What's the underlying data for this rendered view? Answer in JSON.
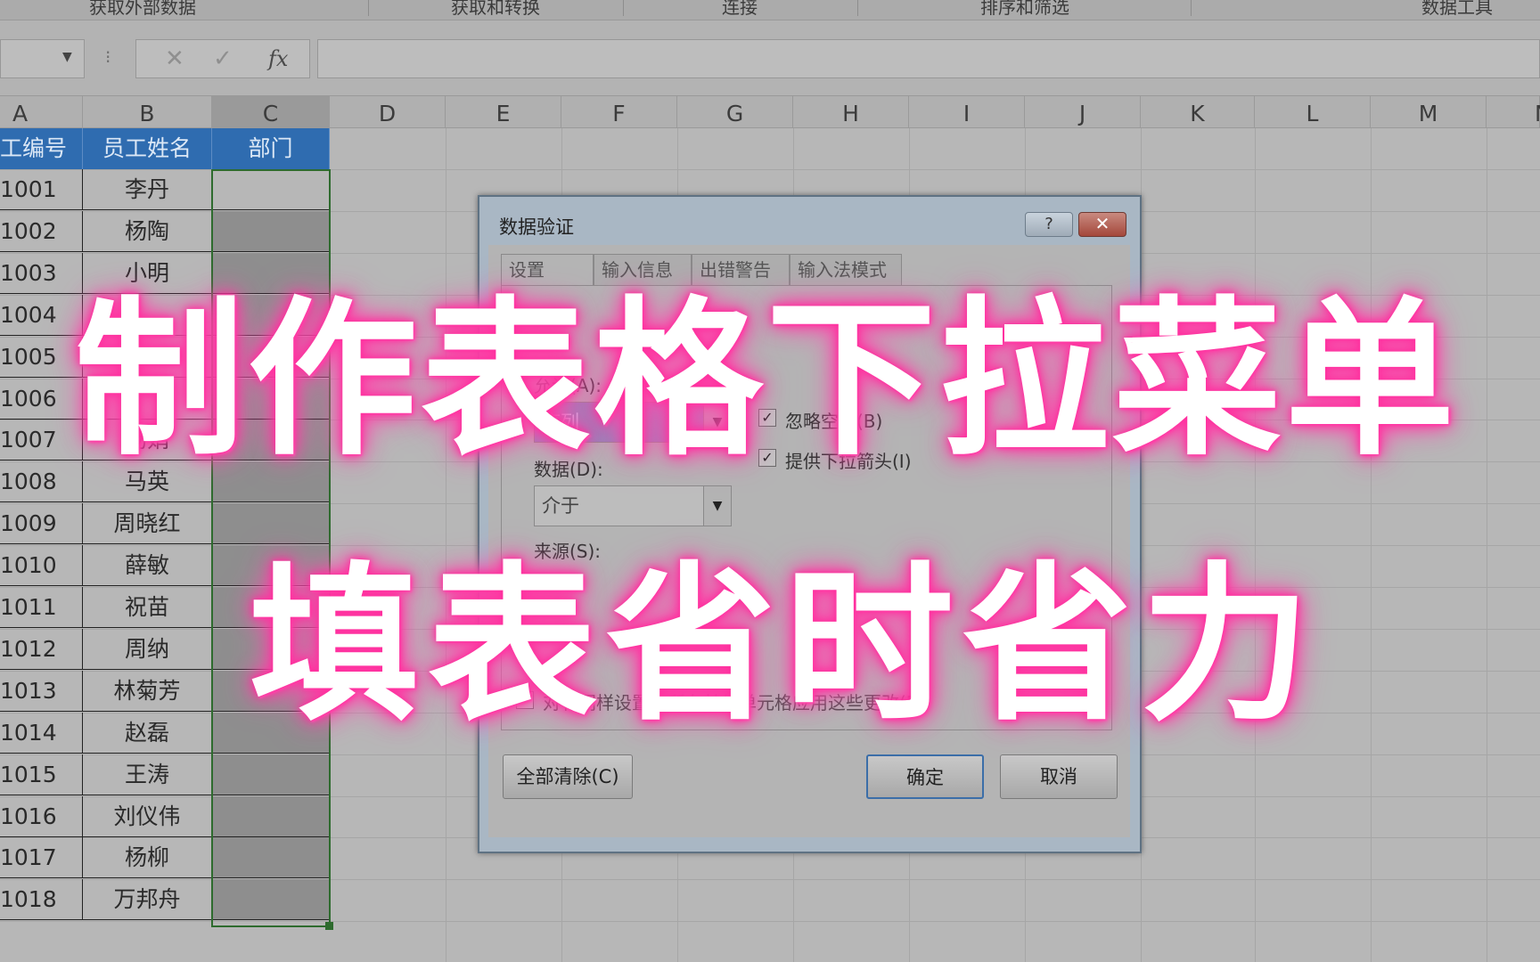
{
  "ribbon": {
    "groups": [
      "获取外部数据",
      "获取和转换",
      "连接",
      "排序和筛选",
      "数据工具"
    ]
  },
  "formula_bar": {
    "cancel_symbol": "✕",
    "enter_symbol": "✓",
    "fx_label": "fx"
  },
  "sheet": {
    "columns": [
      "A",
      "B",
      "C",
      "D",
      "E",
      "F",
      "G",
      "H",
      "I",
      "J",
      "K",
      "L",
      "M",
      "N"
    ],
    "header_row": [
      "工编号",
      "员工姓名",
      "部门"
    ],
    "rows": [
      {
        "id": "1001",
        "name": "李丹"
      },
      {
        "id": "1002",
        "name": "杨陶"
      },
      {
        "id": "1003",
        "name": "小明"
      },
      {
        "id": "1004",
        "name": ""
      },
      {
        "id": "1005",
        "name": ""
      },
      {
        "id": "1006",
        "name": ""
      },
      {
        "id": "1007",
        "name": "杨娟"
      },
      {
        "id": "1008",
        "name": "马英"
      },
      {
        "id": "1009",
        "name": "周晓红"
      },
      {
        "id": "1010",
        "name": "薛敏"
      },
      {
        "id": "1011",
        "name": "祝苗"
      },
      {
        "id": "1012",
        "name": "周纳"
      },
      {
        "id": "1013",
        "name": "林菊芳"
      },
      {
        "id": "1014",
        "name": "赵磊"
      },
      {
        "id": "1015",
        "name": "王涛"
      },
      {
        "id": "1016",
        "name": "刘仪伟"
      },
      {
        "id": "1017",
        "name": "杨柳"
      },
      {
        "id": "1018",
        "name": "万邦舟"
      }
    ],
    "selected_column": "C"
  },
  "dialog": {
    "title": "数据验证",
    "help_label": "?",
    "close_label": "✕",
    "tabs": [
      "设置",
      "输入信息",
      "出错警告",
      "输入法模式"
    ],
    "allow_label": "允许(A):",
    "allow_value": "序列",
    "ignore_blank_label": "忽略空值(B)",
    "dropdown_label": "提供下拉箭头(I)",
    "data_label": "数据(D):",
    "data_value": "介于",
    "source_label": "来源(S):",
    "apply_all_label": "对有同样设置的所有其他单元格应用这些更改(P)",
    "clear_all_label": "全部清除(C)",
    "ok_label": "确定",
    "cancel_label": "取消"
  },
  "overlay": {
    "line1": "制作表格下拉菜单",
    "line2": "填表省时省力"
  },
  "colors": {
    "header_fill": "#2f6cb0",
    "glow": "#ff2f9e"
  }
}
